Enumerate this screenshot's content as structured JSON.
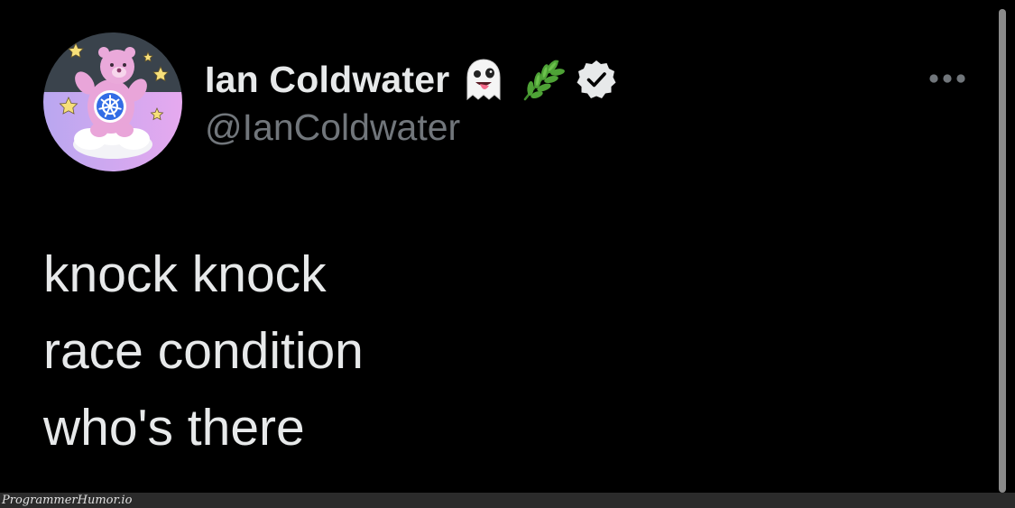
{
  "tweet": {
    "author": {
      "display_name": "Ian Coldwater",
      "handle": "@IanColdwater",
      "name_emojis": [
        "ghost-tongue-emoji",
        "herb-emoji"
      ],
      "verified": true,
      "avatar": "care-bear-kubernetes-avatar"
    },
    "more_menu_icon": "more-horizontal-icon",
    "text_lines": [
      "knock knock",
      "race condition",
      "who's there"
    ]
  },
  "watermark": {
    "text": "ProgrammerHumor.io"
  },
  "colors": {
    "background": "#000000",
    "primary_text": "#e7e9ea",
    "secondary_text": "#71767b",
    "verified_badge": "#e7e9ea",
    "watermark_bar": "#2b2b2b"
  }
}
